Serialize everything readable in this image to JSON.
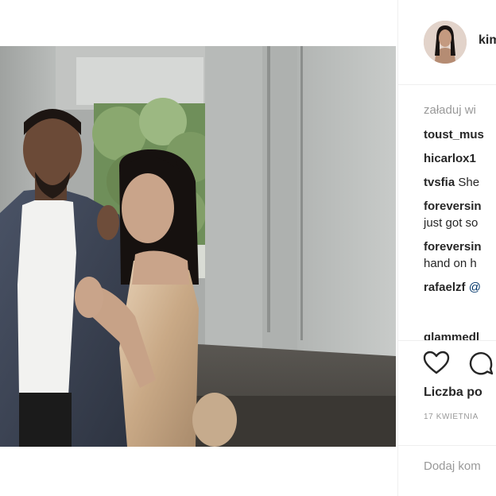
{
  "post": {
    "username": "kim",
    "load_more": "załaduj wi",
    "comments": [
      {
        "user": "toust_mus",
        "text": ""
      },
      {
        "user": "hicarlox1",
        "text": ""
      },
      {
        "user": "tvsfia",
        "text": " She"
      },
      {
        "user": "foreversin",
        "text": "",
        "cont": "just got so"
      },
      {
        "user": "foreversin",
        "text": "",
        "cont": "hand on h"
      },
      {
        "user": "rafaelzf",
        "text": "",
        "mention": " @"
      }
    ],
    "partial_comment_user": "glammedl",
    "likes_label": "Liczba po",
    "date": "17 KWIETNIA",
    "add_comment_placeholder": "Dodaj kom"
  },
  "icons": {
    "like": "heart-icon",
    "comment": "comment-bubble-icon"
  },
  "colors": {
    "text": "#262626",
    "muted": "#999999",
    "mention": "#003569",
    "divider": "#efefef"
  }
}
